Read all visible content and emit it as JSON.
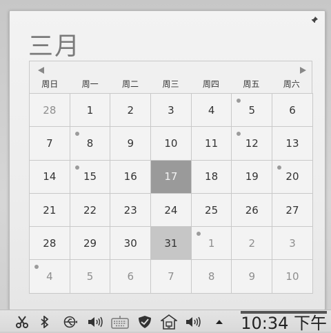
{
  "calendar": {
    "month_title": "三月",
    "weekdays": [
      "周日",
      "周一",
      "周二",
      "周三",
      "周四",
      "周五",
      "周六"
    ],
    "weeks": [
      [
        {
          "d": "28",
          "other": true
        },
        {
          "d": "1"
        },
        {
          "d": "2"
        },
        {
          "d": "3"
        },
        {
          "d": "4"
        },
        {
          "d": "5",
          "dot": true
        },
        {
          "d": "6"
        }
      ],
      [
        {
          "d": "7"
        },
        {
          "d": "8",
          "dot": true
        },
        {
          "d": "9"
        },
        {
          "d": "10"
        },
        {
          "d": "11"
        },
        {
          "d": "12",
          "dot": true
        },
        {
          "d": "13"
        }
      ],
      [
        {
          "d": "14"
        },
        {
          "d": "15",
          "dot": true
        },
        {
          "d": "16"
        },
        {
          "d": "17",
          "today": true
        },
        {
          "d": "18"
        },
        {
          "d": "19"
        },
        {
          "d": "20",
          "dot": true
        }
      ],
      [
        {
          "d": "21"
        },
        {
          "d": "22"
        },
        {
          "d": "23"
        },
        {
          "d": "24"
        },
        {
          "d": "25"
        },
        {
          "d": "26"
        },
        {
          "d": "27"
        }
      ],
      [
        {
          "d": "28"
        },
        {
          "d": "29"
        },
        {
          "d": "30"
        },
        {
          "d": "31",
          "selected": true
        },
        {
          "d": "1",
          "other": true,
          "dot": true
        },
        {
          "d": "2",
          "other": true
        },
        {
          "d": "3",
          "other": true
        }
      ],
      [
        {
          "d": "4",
          "other": true,
          "dot": true
        },
        {
          "d": "5",
          "other": true
        },
        {
          "d": "6",
          "other": true
        },
        {
          "d": "7",
          "other": true
        },
        {
          "d": "8",
          "other": true
        },
        {
          "d": "9",
          "other": true
        },
        {
          "d": "10",
          "other": true
        }
      ]
    ]
  },
  "tray": {
    "icons": [
      "scissors-icon",
      "bluetooth-icon",
      "usb-icon",
      "volume-icon",
      "keyboard-icon",
      "shield-icon",
      "network-icon",
      "speaker-icon",
      "expand-arrow-icon"
    ]
  },
  "clock": {
    "time": "10:34 下午"
  },
  "colors": {
    "today_bg": "#9a9a9a",
    "selected_bg": "#c6c6c6",
    "event_dot": "#9b9b9b"
  }
}
